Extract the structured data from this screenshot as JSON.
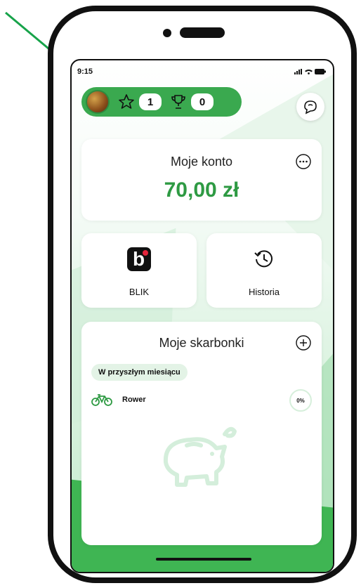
{
  "status_bar": {
    "time": "9:15"
  },
  "header": {
    "stars_count": "1",
    "trophies_count": "0"
  },
  "account": {
    "title": "Moje konto",
    "balance": "70,00 zł"
  },
  "tiles": {
    "blik_label": "BLIK",
    "history_label": "Historia"
  },
  "piggies": {
    "title": "Moje skarbonki",
    "section": "W przyszłym miesiącu",
    "items": [
      {
        "name": "Rower",
        "progress": "0%",
        "icon": "bicycle-icon"
      }
    ]
  },
  "colors": {
    "accent": "#3aa94f",
    "balance": "#2e9a43",
    "blik_dot": "#e4243b"
  }
}
